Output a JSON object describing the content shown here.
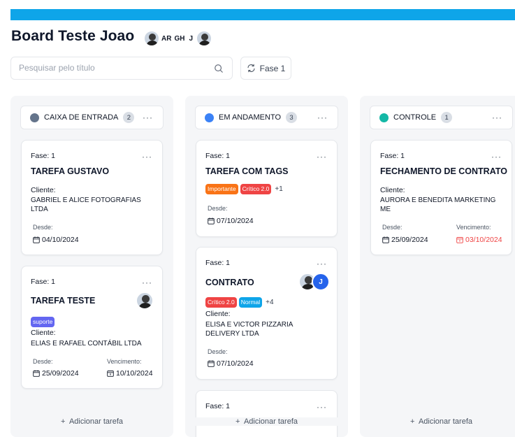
{
  "board": {
    "title": "Board Teste Joao",
    "members": [
      "AR",
      "GH",
      "J"
    ]
  },
  "search": {
    "placeholder": "Pesquisar pelo título",
    "value": ""
  },
  "phase_button": {
    "label": "Fase 1"
  },
  "colors": {
    "accent_bar": "#0ea5e9",
    "overdue": "#ef4444"
  },
  "columns": [
    {
      "name": "CAIXA DE ENTRADA",
      "count": "2",
      "dot_color": "#64748b",
      "add_label": "Adicionar tarefa",
      "cards": [
        {
          "fase": "Fase: 1",
          "title": "TAREFA GUSTAVO",
          "client_label": "Cliente:",
          "client": "GABRIEL E ALICE FOTOGRAFIAS LTDA",
          "since_label": "Desde:",
          "since": "04/10/2024"
        },
        {
          "fase": "Fase: 1",
          "title": "TAREFA TESTE",
          "tag": "suporte",
          "client_label": "Cliente:",
          "client": "ELIAS E RAFAEL CONTÁBIL LTDA",
          "since_label": "Desde:",
          "since": "25/09/2024",
          "due_label": "Vencimento:",
          "due": "10/10/2024"
        }
      ]
    },
    {
      "name": "EM ANDAMENTO",
      "count": "3",
      "dot_color": "#3b82f6",
      "add_label": "Adicionar tarefa",
      "cards": [
        {
          "fase": "Fase: 1",
          "title": "TAREFA COM TAGS",
          "tags": [
            "Importante",
            "Crítico 2.0"
          ],
          "more_tags": "+1",
          "since_label": "Desde:",
          "since": "07/10/2024"
        },
        {
          "fase": "Fase: 1",
          "title": "CONTRATO",
          "tags": [
            "Crítico 2.0",
            "Normal"
          ],
          "more_tags": "+4",
          "avatar_letter": "J",
          "client_label": "Cliente:",
          "client": "ELISA E VICTOR PIZZARIA DELIVERY LTDA",
          "since_label": "Desde:",
          "since": "07/10/2024"
        },
        {
          "fase": "Fase: 1"
        }
      ]
    },
    {
      "name": "CONTROLE",
      "count": "1",
      "dot_color": "#14b8a6",
      "add_label": "Adicionar tarefa",
      "cards": [
        {
          "fase": "Fase: 1",
          "title": "FECHAMENTO DE CONTRATO",
          "client_label": "Cliente:",
          "client": "AURORA E BENEDITA MARKETING ME",
          "since_label": "Desde:",
          "since": "25/09/2024",
          "due_label": "Vencimento:",
          "due": "03/10/2024"
        }
      ]
    }
  ],
  "tag_colors": {
    "Importante": "#f97316",
    "Crítico 2.0": "#ef4444",
    "Normal": "#0ea5e9",
    "suporte": "#6366f1"
  },
  "icons": {
    "search": "search-icon",
    "refresh": "refresh-icon",
    "calendar": "calendar-icon",
    "more": "more-horizontal-icon",
    "plus": "plus-icon"
  }
}
